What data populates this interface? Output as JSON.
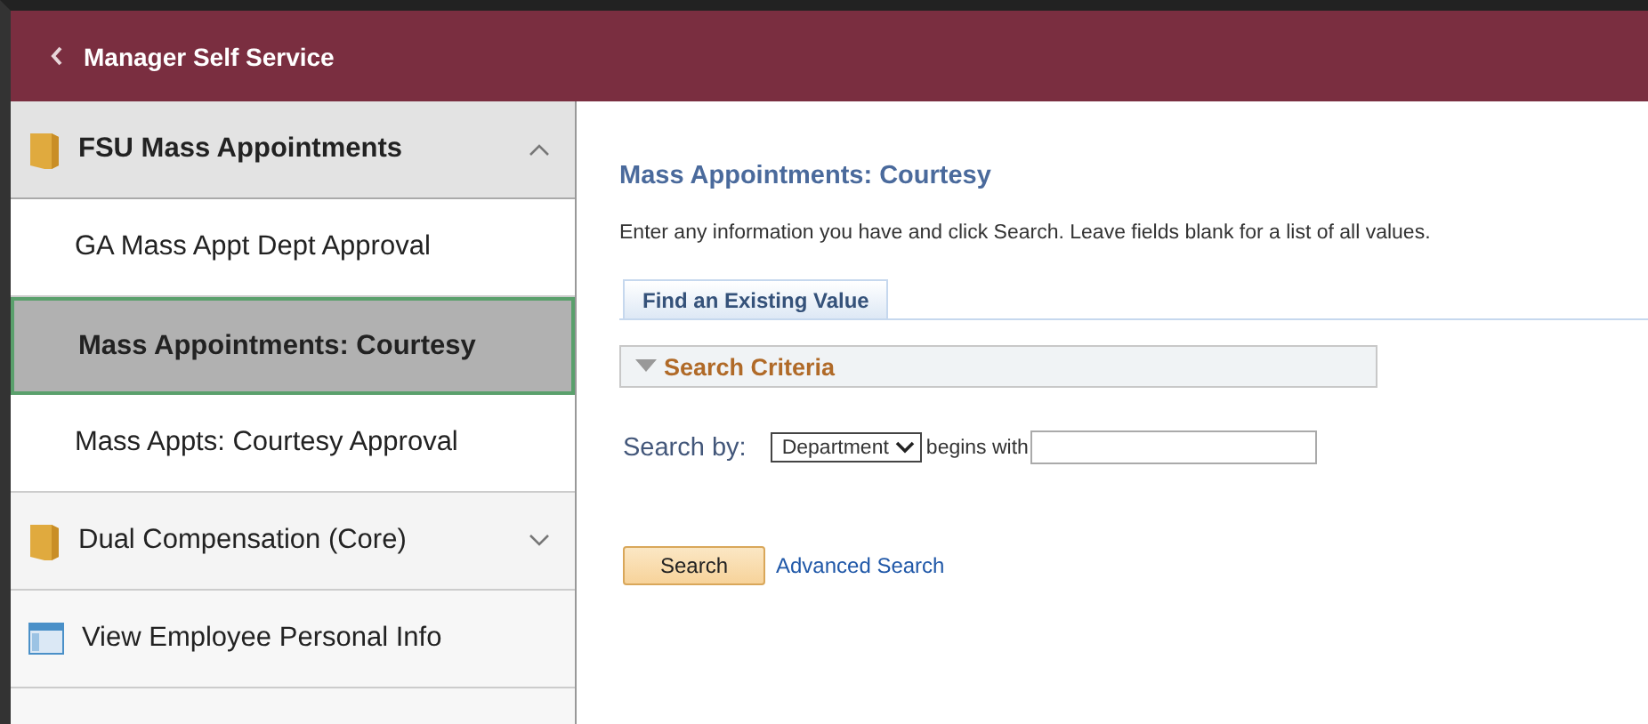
{
  "header": {
    "back_label": "Manager Self Service"
  },
  "sidebar": {
    "items": [
      {
        "kind": "folder",
        "label": "FSU Mass Appointments",
        "expanded": true,
        "children": [
          {
            "label": "GA Mass Appt Dept Approval",
            "selected": false
          },
          {
            "label": "Mass Appointments: Courtesy",
            "selected": true
          },
          {
            "label": "Mass Appts: Courtesy Approval",
            "selected": false
          }
        ]
      },
      {
        "kind": "folder",
        "label": "Dual Compensation (Core)",
        "expanded": false
      },
      {
        "kind": "page",
        "label": "View Employee Personal Info"
      }
    ]
  },
  "content": {
    "title": "Mass Appointments: Courtesy",
    "instructions": "Enter any information you have and click Search. Leave fields blank for a list of all values.",
    "tabs": [
      {
        "label": "Find an Existing Value",
        "selected": true
      }
    ],
    "section": {
      "label": "Search Criteria",
      "expanded": true
    },
    "search_by": {
      "label": "Search by:",
      "value": "Department",
      "operator": "begins with"
    },
    "search_button": "Search",
    "advanced_link": "Advanced Search"
  }
}
